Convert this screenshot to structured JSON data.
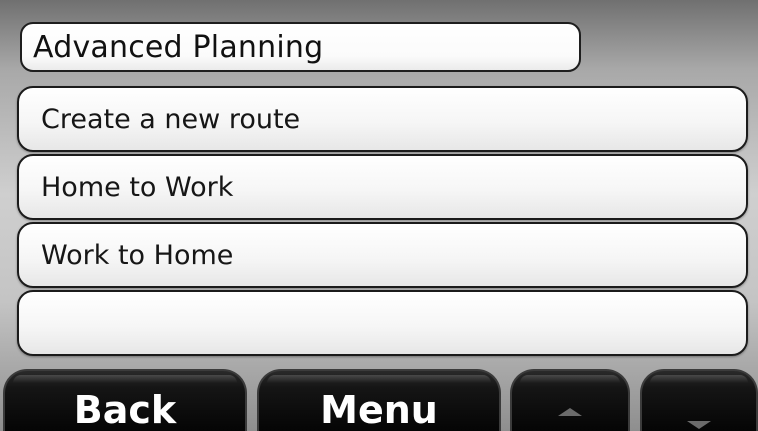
{
  "screen": {
    "title": "Advanced Planning",
    "items": [
      {
        "label": "Create a new route"
      },
      {
        "label": "Home to Work"
      },
      {
        "label": "Work to Home"
      },
      {
        "label": ""
      }
    ]
  },
  "softkeys": {
    "back": "Back",
    "menu": "Menu",
    "up_icon": "arrow-up-icon",
    "down_icon": "arrow-down-icon"
  },
  "colors": {
    "background_top": "#707070",
    "background_middle": "#cfcfcf",
    "list_item": "#ffffff",
    "softkey": "#050505",
    "softkey_text": "#ffffff"
  }
}
